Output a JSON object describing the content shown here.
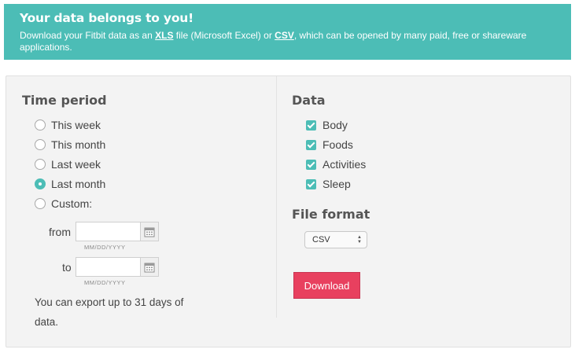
{
  "banner": {
    "title": "Your data belongs to you!",
    "text_before": "Download your Fitbit data as an ",
    "xls_link": "XLS",
    "text_middle_1": " file (Microsoft Excel) or ",
    "csv_link": "CSV",
    "text_after": ", which can be opened by many paid, free or shareware applications.",
    "background_color": "#4cbdb6"
  },
  "time_period": {
    "title": "Time period",
    "options": [
      {
        "label": "This week",
        "checked": false
      },
      {
        "label": "This month",
        "checked": false
      },
      {
        "label": "Last week",
        "checked": false
      },
      {
        "label": "Last month",
        "checked": true
      },
      {
        "label": "Custom:",
        "checked": false
      }
    ],
    "from": {
      "label": "from",
      "value": "",
      "hint": "MM/DD/YYYY",
      "icon": "calendar-icon"
    },
    "to": {
      "label": "to",
      "value": "",
      "hint": "MM/DD/YYYY",
      "icon": "calendar-icon"
    },
    "note": "You can export up to 31 days of data."
  },
  "data": {
    "title": "Data",
    "options": [
      {
        "label": "Body",
        "checked": true
      },
      {
        "label": "Foods",
        "checked": true
      },
      {
        "label": "Activities",
        "checked": true
      },
      {
        "label": "Sleep",
        "checked": true
      }
    ]
  },
  "file_format": {
    "title": "File format",
    "selected": "CSV"
  },
  "download": {
    "label": "Download",
    "color": "#e8405f"
  }
}
